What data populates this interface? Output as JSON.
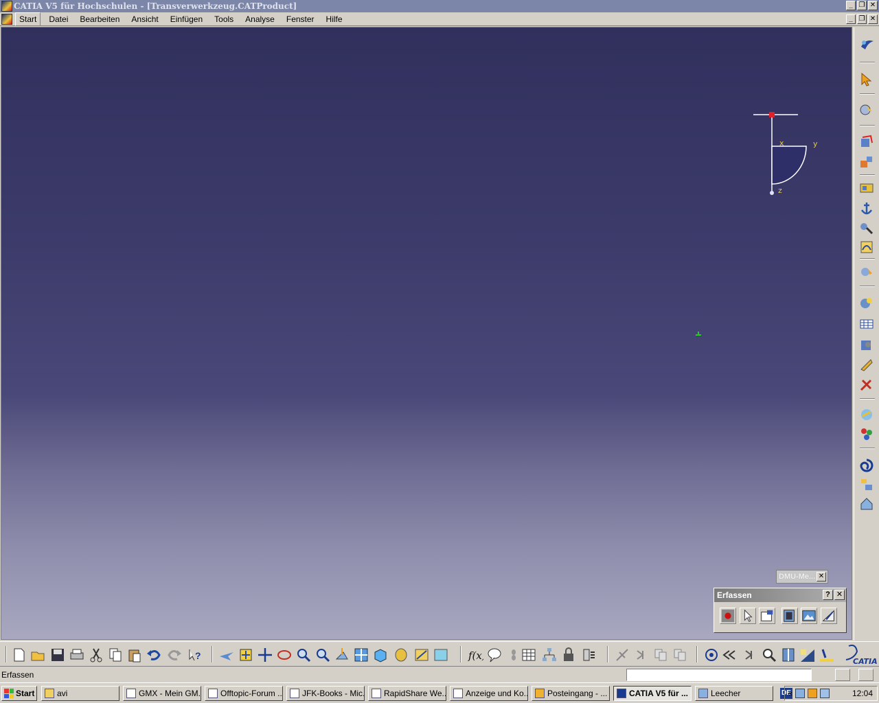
{
  "window": {
    "title": "CATIA V5 für Hochschulen - [Transverwerkzeug.CATProduct]",
    "controls": [
      "_",
      "❐",
      "✕"
    ]
  },
  "menubar": {
    "items": [
      "Start",
      "Datei",
      "Bearbeiten",
      "Ansicht",
      "Einfügen",
      "Tools",
      "Analyse",
      "Fenster",
      "Hilfe"
    ]
  },
  "axis": {
    "x_label": "x",
    "y_label": "y",
    "z_label": "z"
  },
  "dmu_toolbar": {
    "title": "DMU-Me...",
    "close": "✕"
  },
  "erfassen_toolbar": {
    "title": "Erfassen",
    "help": "?",
    "close": "✕",
    "icons": [
      "record-icon",
      "select-icon",
      "options-icon",
      "capture-icon",
      "image-album-icon",
      "measure-icon"
    ]
  },
  "right_toolbar": {
    "icons": [
      "catia-logo-icon",
      "select-arrow-icon",
      "manipulate-icon",
      "snap-icon",
      "explode-icon",
      "assembly-constraint-icon",
      "anchor-icon",
      "fix-together-icon",
      "reuse-pattern-icon",
      "measure-between-icon",
      "space-analysis-icon",
      "sectioning-icon",
      "clash-icon",
      "distance-icon",
      "tools-icon",
      "catalog-icon",
      "material-icon",
      "swept-volume-icon",
      "product-structure-icon",
      "publish-icon"
    ]
  },
  "bottom_toolbar": {
    "icons": [
      "new-icon",
      "open-icon",
      "save-icon",
      "print-icon",
      "cut-icon",
      "copy-icon",
      "paste-icon",
      "undo-icon",
      "redo-icon",
      "whats-this-icon",
      "fly-mode-icon",
      "fit-all-icon",
      "pan-icon",
      "rotate-icon",
      "zoom-in-icon",
      "zoom-out-icon",
      "normal-view-icon",
      "multi-view-icon",
      "iso-view-icon",
      "shading-icon",
      "hide-show-icon",
      "swap-visible-icon",
      "formula-icon",
      "comment-icon",
      "knowledge-icon",
      "table-icon",
      "graph-icon",
      "lock-icon",
      "param-icon",
      "annotate-icon",
      "next-icon",
      "copy-prop-icon",
      "paste-prop-icon",
      "target-icon",
      "first-icon",
      "last-icon",
      "search-icon",
      "walk-icon",
      "lighting-icon",
      "depth-icon"
    ]
  },
  "statusbar": {
    "text": "Erfassen",
    "input_value": ""
  },
  "taskbar": {
    "start_label": "Start",
    "tasks": [
      "avi",
      "GMX - Mein GM...",
      "Offtopic-Forum ...",
      "JFK-Books - Mic...",
      "RapidShare We...",
      "Anzeige und Ko...",
      "Posteingang - ...",
      "CATIA V5 für ...",
      "Leecher"
    ],
    "active_task": "CATIA V5 für ...",
    "language": "DE",
    "tray_prefix": "«",
    "clock": "12:04"
  },
  "colors": {
    "viewport_top": "#31305d",
    "viewport_bottom": "#a9a8c0",
    "axis_line": "#ffffff",
    "axis_label": "#e5c94a",
    "origin_marker": "#e0202a"
  }
}
